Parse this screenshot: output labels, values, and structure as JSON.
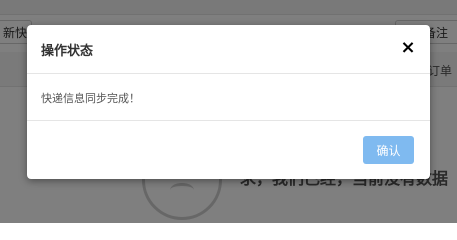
{
  "background": {
    "toolbar_chip_left": "新快递",
    "toolbar_chip_right": "修改备注",
    "tab_orders": "订单",
    "empty_text": "求，我们已经，当前没有数据"
  },
  "dialog": {
    "title": "操作状态",
    "close_glyph": "×",
    "message": "快递信息同步完成！",
    "confirm_label": "确认"
  },
  "colors": {
    "overlay": "rgba(0,0,0,0.5)",
    "confirm_button_bg": "#7fbaf0"
  }
}
